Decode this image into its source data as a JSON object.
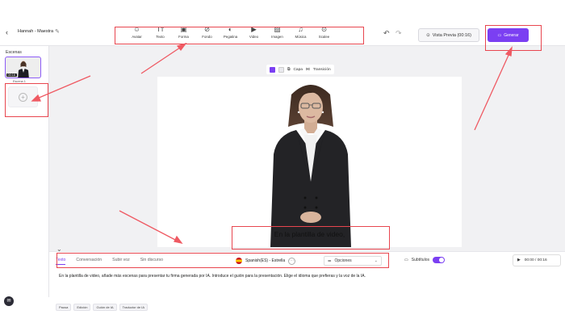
{
  "header": {
    "back_icon": "chevron-left-icon",
    "project_title": "Hannah - Maestra",
    "tools": [
      {
        "label": "Avatar",
        "icon": "avatar-icon",
        "glyph": "☺"
      },
      {
        "label": "Texto",
        "icon": "text-icon",
        "glyph": "Tт"
      },
      {
        "label": "Forma",
        "icon": "shape-icon",
        "glyph": "▣"
      },
      {
        "label": "Fondo",
        "icon": "background-icon",
        "glyph": "⊘"
      },
      {
        "label": "Pegatina",
        "icon": "sticker-icon",
        "glyph": "◐"
      },
      {
        "label": "Video",
        "icon": "video-icon",
        "glyph": "▶"
      },
      {
        "label": "Imagen",
        "icon": "image-icon",
        "glyph": "▨"
      },
      {
        "label": "Música",
        "icon": "music-icon",
        "glyph": "♫"
      },
      {
        "label": "Scalee",
        "icon": "pin-icon",
        "glyph": "⊙"
      }
    ],
    "preview_label": "Vista Previa (00:16)",
    "generate_label": "Generar"
  },
  "scenes": {
    "title": "Escenas",
    "thumb_time": "00:16",
    "scene_name": "Escena 1"
  },
  "canvas": {
    "toolbar": {
      "layer_label": "Capa",
      "transition_label": "Transición"
    },
    "colors": [
      "#7b3ff2",
      "#e9e9ee"
    ],
    "subtitle": "En la plantilla de video,"
  },
  "editor": {
    "tabs": [
      "Texto",
      "Conversación",
      "Subir voz",
      "Sin discurso"
    ],
    "voice": "Spanish(ES) - Estrella",
    "options_label": "Opciones",
    "subtitles_label": "Subtítulos",
    "subtitles_on": true,
    "time_display": "00:00 / 00:16",
    "script_text": "En la plantilla de video, añade más escenas para presentar tu firma generada por IA. Introduce el guión para la presentación. Elige el idioma que prefieras y la voz de la IA.",
    "chips": [
      "Pausa",
      "Edición",
      "Guión de IA",
      "Traductor de IA"
    ]
  },
  "accent_color": "#7b3ff2",
  "highlight_color": "#e8464f"
}
